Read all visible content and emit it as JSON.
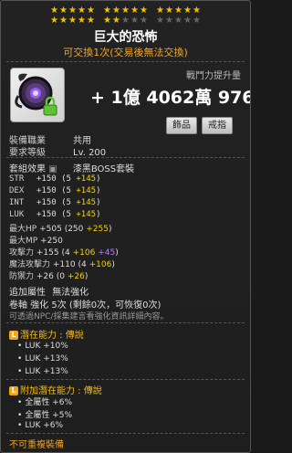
{
  "stars": {
    "groups": [
      [
        1,
        1,
        1,
        1,
        1
      ],
      [
        1,
        1,
        1,
        1,
        1
      ],
      [
        1,
        1,
        1,
        1,
        1
      ],
      [
        1,
        1,
        1,
        1,
        1
      ],
      [
        1,
        1,
        0,
        0,
        0
      ],
      [
        0,
        0,
        0,
        0,
        0
      ]
    ]
  },
  "item": {
    "name": "巨大的恐怖",
    "trade_note": "可交換1次(交易後無法交換)",
    "cp_label": "戰鬥力提升量",
    "cp_value": "+ 1億 4062萬 976",
    "btn_accessory": "飾品",
    "btn_ring": "戒指",
    "icon_name": "dark-scythe-ring-icon"
  },
  "info": {
    "job_label": "裝備職業",
    "job_value": "共用",
    "level_label": "要求等級",
    "level_value": "Lv. 200"
  },
  "set": {
    "label": "套組效果",
    "value": "漆黑BOSS套裝"
  },
  "stats": [
    {
      "name": "STR",
      "total": "+150",
      "base": "(5",
      "bonus": "+145",
      "close": ")"
    },
    {
      "name": "DEX",
      "total": "+150",
      "base": "(5",
      "bonus": "+145",
      "close": ")"
    },
    {
      "name": "INT",
      "total": "+150",
      "base": "(5",
      "bonus": "+145",
      "close": ")"
    },
    {
      "name": "LUK",
      "total": "+150",
      "base": "(5",
      "bonus": "+145",
      "close": ")"
    }
  ],
  "stats2": [
    {
      "name": "最大HP",
      "total": "+505",
      "base": "(250",
      "bonus": "+255",
      "close": ")"
    },
    {
      "name": "最大MP",
      "total": "+250",
      "base": "",
      "bonus": "",
      "close": ""
    },
    {
      "name": "攻擊力",
      "total": "+155",
      "base": "(4",
      "bonus": "+106",
      "extra": "+45",
      "close": ")"
    },
    {
      "name": "魔法攻擊力",
      "total": "+110",
      "base": "(4",
      "bonus": "+106",
      "close": ")"
    },
    {
      "name": "防禦力",
      "total": "+26",
      "base": "(0",
      "bonus": "+26",
      "close": ")"
    }
  ],
  "extra_attr": {
    "label": "追加屬性",
    "value": "無法強化",
    "scroll": "卷軸 強化 5次 (剩餘0次，可恢復0次)",
    "note": "可透過NPC/採集建言看強化資訊詳細內容。"
  },
  "potential": {
    "badge": "L",
    "label": "潛在能力 : 傳說",
    "lines": [
      "LUK +10%",
      "LUK +13%",
      "LUK +13%"
    ]
  },
  "additional": {
    "badge": "L",
    "label": "附加潛在能力 : 傳說",
    "lines": [
      "全屬性 +6%",
      "全屬性 +5%",
      "LUK +6%"
    ]
  },
  "footer": "不可重複裝備",
  "colors": {
    "accent_yellow": "#f5d000",
    "purple": "#b97cf5",
    "gold": "#f0b91c",
    "orange": "#f5a623"
  }
}
